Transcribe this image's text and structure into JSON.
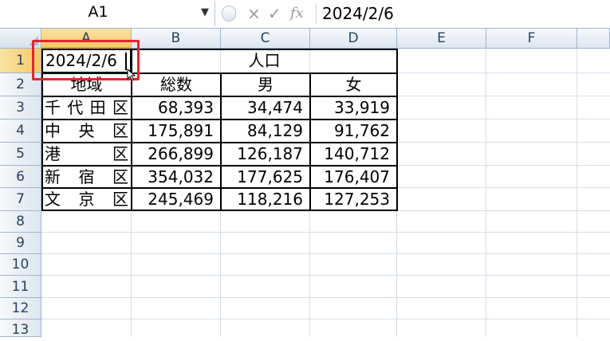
{
  "name_box": "A1",
  "formula_bar": {
    "cancel_icon": "×",
    "enter_icon": "✓",
    "function_icon": "fx",
    "value": "2024/2/6"
  },
  "columns": [
    "A",
    "B",
    "C",
    "D",
    "E",
    "F"
  ],
  "rows": [
    "1",
    "2",
    "3",
    "4",
    "5",
    "6",
    "7",
    "8",
    "9",
    "10",
    "11",
    "12",
    "13"
  ],
  "table": {
    "active_cell_value": "2024/2/6",
    "group_header": "人口",
    "headers": [
      "地域",
      "総数",
      "男",
      "女"
    ],
    "data": [
      {
        "region": [
          "千",
          "代",
          "田",
          "区"
        ],
        "total": "68,393",
        "male": "34,474",
        "female": "33,919"
      },
      {
        "region": [
          "中",
          "央",
          "区"
        ],
        "total": "175,891",
        "male": "84,129",
        "female": "91,762"
      },
      {
        "region": [
          "港",
          "区"
        ],
        "total": "266,899",
        "male": "126,187",
        "female": "140,712"
      },
      {
        "region": [
          "新",
          "宿",
          "区"
        ],
        "total": "354,032",
        "male": "177,625",
        "female": "176,407"
      },
      {
        "region": [
          "文",
          "京",
          "区"
        ],
        "total": "245,469",
        "male": "118,216",
        "female": "127,253"
      }
    ]
  },
  "colors": {
    "highlight": "#e8232b",
    "selected_header": "#f6c868",
    "header_bg": "#dde6ef",
    "gridline": "#d4dde7"
  }
}
